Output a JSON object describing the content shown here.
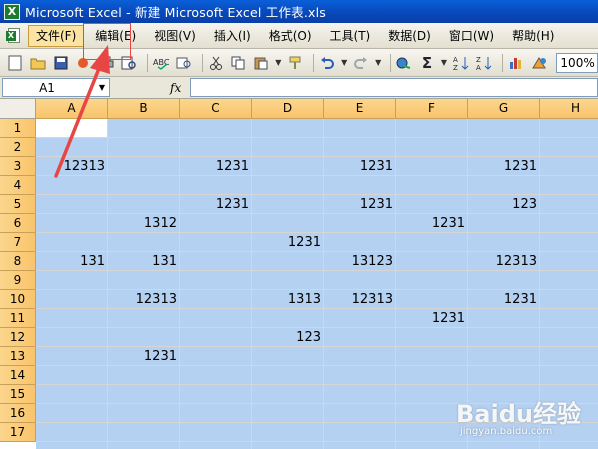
{
  "window": {
    "title": "Microsoft Excel - 新建 Microsoft Excel 工作表.xls"
  },
  "menu": {
    "items": [
      {
        "label": "文件(F)",
        "active": true
      },
      {
        "label": "编辑(E)",
        "active": false
      },
      {
        "label": "视图(V)",
        "active": false
      },
      {
        "label": "插入(I)",
        "active": false
      },
      {
        "label": "格式(O)",
        "active": false
      },
      {
        "label": "工具(T)",
        "active": false
      },
      {
        "label": "数据(D)",
        "active": false
      },
      {
        "label": "窗口(W)",
        "active": false
      },
      {
        "label": "帮助(H)",
        "active": false
      }
    ]
  },
  "toolbar": {
    "icons": [
      "new-icon",
      "open-icon",
      "save-icon",
      "permission-icon",
      "print-icon",
      "print-preview-icon",
      "spelling-icon",
      "research-icon",
      "cut-icon",
      "copy-icon",
      "paste-icon",
      "format-painter-icon",
      "undo-icon",
      "redo-icon",
      "hyperlink-icon",
      "autosum-icon",
      "sort-ascending-icon",
      "sort-descending-icon",
      "chart-wizard-icon",
      "drawing-icon"
    ],
    "zoom": "100%"
  },
  "formula_bar": {
    "name_box": "A1",
    "fx_label": "fx",
    "formula": ""
  },
  "sheet": {
    "columns": [
      "A",
      "B",
      "C",
      "D",
      "E",
      "F",
      "G",
      "H"
    ],
    "rows": [
      "1",
      "2",
      "3",
      "4",
      "5",
      "6",
      "7",
      "8",
      "9",
      "10",
      "11",
      "12",
      "13",
      "14",
      "15",
      "16",
      "17"
    ],
    "cells": [
      {
        "row": 3,
        "col": 0,
        "value": "12313"
      },
      {
        "row": 3,
        "col": 2,
        "value": "1231"
      },
      {
        "row": 3,
        "col": 4,
        "value": "1231"
      },
      {
        "row": 3,
        "col": 6,
        "value": "1231"
      },
      {
        "row": 5,
        "col": 2,
        "value": "1231"
      },
      {
        "row": 5,
        "col": 4,
        "value": "1231"
      },
      {
        "row": 5,
        "col": 6,
        "value": "123"
      },
      {
        "row": 6,
        "col": 1,
        "value": "1312"
      },
      {
        "row": 6,
        "col": 5,
        "value": "1231"
      },
      {
        "row": 7,
        "col": 3,
        "value": "1231"
      },
      {
        "row": 8,
        "col": 0,
        "value": "131"
      },
      {
        "row": 8,
        "col": 1,
        "value": "131"
      },
      {
        "row": 8,
        "col": 4,
        "value": "13123"
      },
      {
        "row": 8,
        "col": 6,
        "value": "12313"
      },
      {
        "row": 10,
        "col": 1,
        "value": "12313"
      },
      {
        "row": 10,
        "col": 3,
        "value": "1313"
      },
      {
        "row": 10,
        "col": 4,
        "value": "12313"
      },
      {
        "row": 10,
        "col": 6,
        "value": "1231"
      },
      {
        "row": 11,
        "col": 5,
        "value": "1231"
      },
      {
        "row": 12,
        "col": 3,
        "value": "123"
      },
      {
        "row": 13,
        "col": 1,
        "value": "1231"
      }
    ]
  },
  "watermark": {
    "logo": "Baidu经验",
    "url": "jingyan.baidu.com"
  },
  "colors": {
    "selection": "#b4d1f2",
    "header": "#f9c46b",
    "annotation": "#e84545"
  }
}
